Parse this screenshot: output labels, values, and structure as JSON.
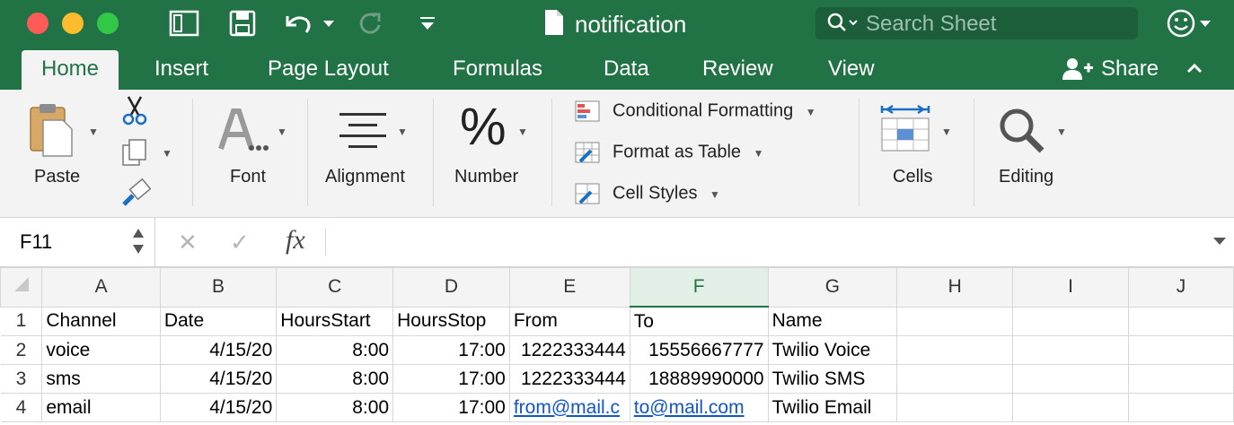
{
  "window": {
    "title": "notification"
  },
  "search": {
    "placeholder": "Search Sheet"
  },
  "tabs": [
    "Home",
    "Insert",
    "Page Layout",
    "Formulas",
    "Data",
    "Review",
    "View"
  ],
  "share_label": "Share",
  "ribbon": {
    "paste": "Paste",
    "font": "Font",
    "alignment": "Alignment",
    "number": "Number",
    "conditional_formatting": "Conditional Formatting",
    "format_as_table": "Format as Table",
    "cell_styles": "Cell Styles",
    "cells": "Cells",
    "editing": "Editing"
  },
  "formula_bar": {
    "name_box": "F11",
    "fx": "fx",
    "value": ""
  },
  "sheet": {
    "columns": [
      "A",
      "B",
      "C",
      "D",
      "E",
      "F",
      "G",
      "H",
      "I",
      "J"
    ],
    "selected_column": "F",
    "rows": [
      {
        "n": "1",
        "cells": [
          "Channel",
          "Date",
          "HoursStart",
          "HoursStop",
          "From",
          "To",
          "Name",
          "",
          "",
          ""
        ]
      },
      {
        "n": "2",
        "cells": [
          "voice",
          "4/15/20",
          "8:00",
          "17:00",
          "1222333444",
          "15556667777",
          "Twilio Voice",
          "",
          "",
          ""
        ]
      },
      {
        "n": "3",
        "cells": [
          "sms",
          "4/15/20",
          "8:00",
          "17:00",
          "1222333444",
          "18889990000",
          "Twilio SMS",
          "",
          "",
          ""
        ]
      },
      {
        "n": "4",
        "cells": [
          "email",
          "4/15/20",
          "8:00",
          "17:00",
          "from@mail.c",
          "to@mail.com",
          "Twilio Email",
          "",
          "",
          ""
        ]
      }
    ]
  },
  "colors": {
    "brand": "#217346",
    "link": "#1155cc"
  }
}
